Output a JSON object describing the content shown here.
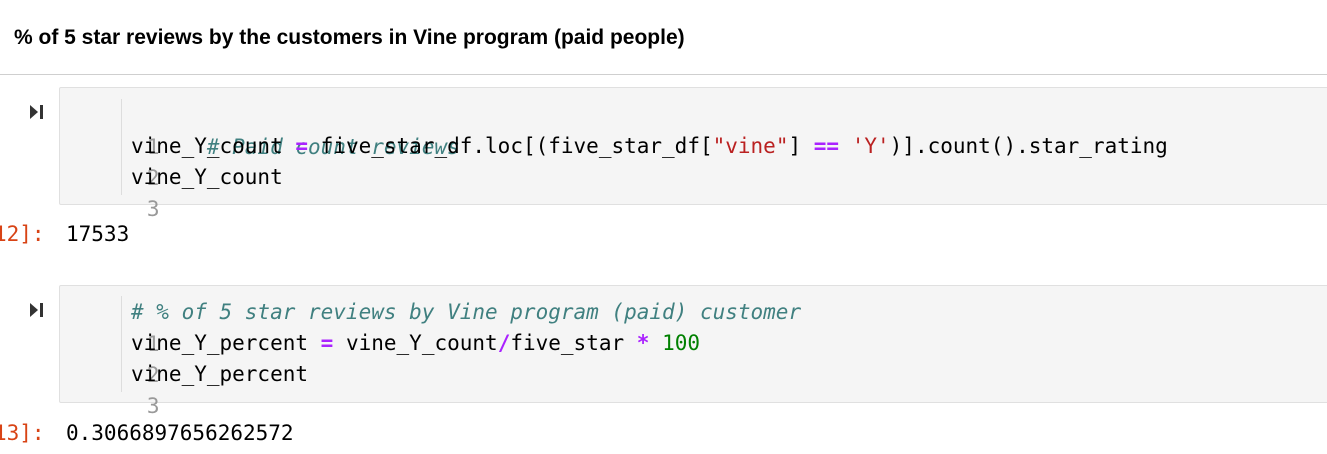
{
  "heading": "% of 5 star reviews by the customers in Vine program (paid people)",
  "cells": [
    {
      "lines": [
        {
          "no": "1",
          "tokens": [
            {
              "t": "# Paid count reviews",
              "c": "cm"
            }
          ]
        },
        {
          "no": "2",
          "tokens": [
            {
              "t": "vine_Y_count ",
              "c": ""
            },
            {
              "t": "=",
              "c": "op"
            },
            {
              "t": " five_star_df.loc[(five_star_df[",
              "c": ""
            },
            {
              "t": "\"vine\"",
              "c": "str"
            },
            {
              "t": "] ",
              "c": ""
            },
            {
              "t": "==",
              "c": "op"
            },
            {
              "t": " ",
              "c": ""
            },
            {
              "t": "'Y'",
              "c": "str"
            },
            {
              "t": ")].count().star_rating",
              "c": ""
            }
          ]
        },
        {
          "no": "3",
          "tokens": [
            {
              "t": "vine_Y_count",
              "c": ""
            }
          ]
        }
      ],
      "prompt": "12]:",
      "output": "17533"
    },
    {
      "lines": [
        {
          "no": "1",
          "tokens": [
            {
              "t": "# % of 5 star reviews by Vine program (paid) customer",
              "c": "cm"
            }
          ]
        },
        {
          "no": "2",
          "tokens": [
            {
              "t": "vine_Y_percent ",
              "c": ""
            },
            {
              "t": "=",
              "c": "op"
            },
            {
              "t": " vine_Y_count",
              "c": ""
            },
            {
              "t": "/",
              "c": "op"
            },
            {
              "t": "five_star ",
              "c": ""
            },
            {
              "t": "*",
              "c": "op"
            },
            {
              "t": " ",
              "c": ""
            },
            {
              "t": "100",
              "c": "num"
            }
          ]
        },
        {
          "no": "3",
          "tokens": [
            {
              "t": "vine_Y_percent",
              "c": ""
            }
          ]
        }
      ],
      "prompt": "13]:",
      "output": "0.3066897656262572"
    }
  ]
}
